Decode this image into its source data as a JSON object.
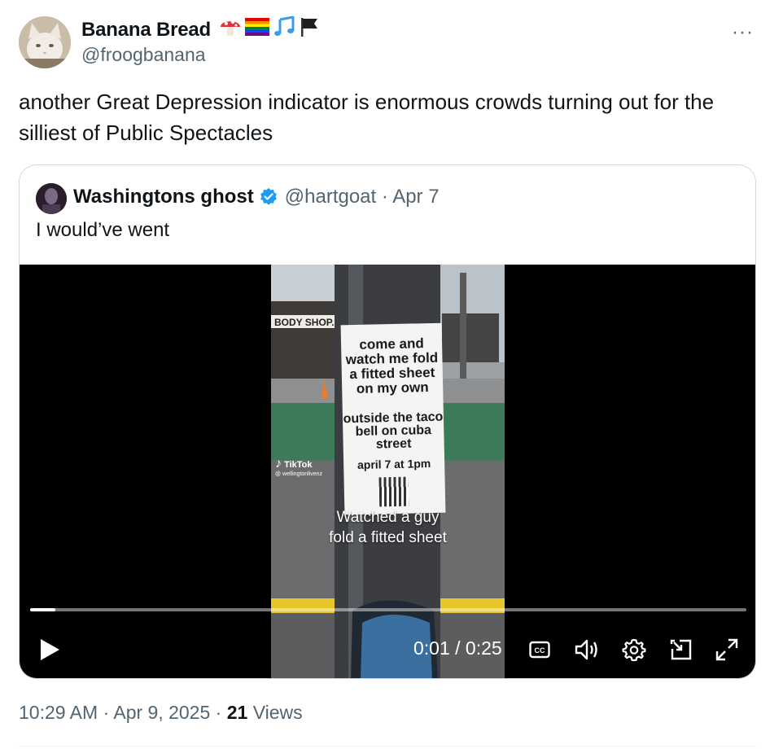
{
  "author": {
    "name": "Banana Bread",
    "emojis": [
      "mushroom-icon",
      "rainbow-flag-icon",
      "music-notes-icon",
      "black-flag-icon"
    ],
    "handle": "@froogbanana"
  },
  "more_label": "···",
  "tweet_text": "another Great Depression indicator is enormous crowds turning out for the silliest of Public Spectacles",
  "quoted": {
    "name": "Washingtons ghost",
    "verified": true,
    "handle_date": "@hartgoat · Apr 7",
    "text": "I would’ve went",
    "video": {
      "poster_line1": "come and watch me fold a fitted sheet on my own",
      "poster_line2": "outside the taco bell on cuba street",
      "poster_line3": "april 7 at 1pm",
      "shop_sign": "BODY SHOP.",
      "tiktok_label": "TikTok",
      "tiktok_handle": "@ wellingtonlivenz",
      "caption_line1": "Watched a guy",
      "caption_line2": "fold a fitted sheet",
      "time": "0:01 / 0:25",
      "progress": 0.035
    }
  },
  "meta": {
    "time_date": "10:29 AM · Apr 9, 2025 · ",
    "views_count": "21",
    "views_label": " Views"
  },
  "colors": {
    "text": "#0f1419",
    "secondary": "#536471",
    "border": "#cfd9de",
    "verified": "#1d9bf0"
  }
}
